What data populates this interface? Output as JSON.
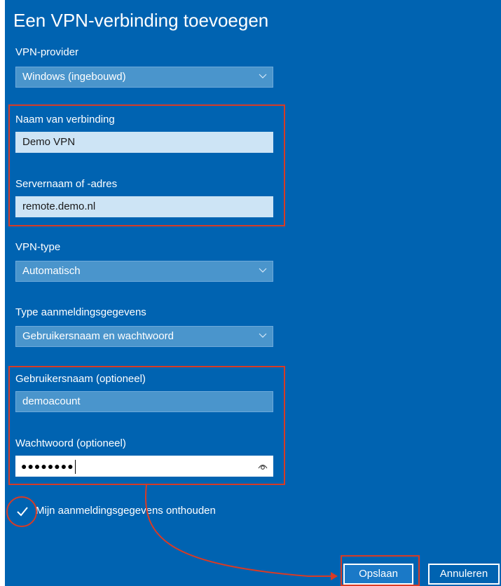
{
  "dialog": {
    "title": "Een VPN-verbinding toevoegen"
  },
  "vpn_provider": {
    "label": "VPN-provider",
    "value": "Windows (ingebouwd)"
  },
  "connection_name": {
    "label": "Naam van verbinding",
    "value": "Demo VPN"
  },
  "server": {
    "label": "Servernaam of -adres",
    "value": "remote.demo.nl"
  },
  "vpn_type": {
    "label": "VPN-type",
    "value": "Automatisch"
  },
  "credential_type": {
    "label": "Type aanmeldingsgegevens",
    "value": "Gebruikersnaam en wachtwoord"
  },
  "username": {
    "label": "Gebruikersnaam (optioneel)",
    "value": "demoacount"
  },
  "password": {
    "label": "Wachtwoord (optioneel)",
    "masked_value": "●●●●●●●●"
  },
  "remember": {
    "label": "Mijn aanmeldingsgegevens onthouden",
    "checked": true
  },
  "buttons": {
    "save": "Opslaan",
    "cancel": "Annuleren"
  },
  "colors": {
    "background": "#0063b1",
    "annotation": "#d83b25",
    "field_light": "#cde4f5",
    "field_dim": "#4a95cc"
  },
  "icons": {
    "dropdown": "chevron-down-icon",
    "reveal_password": "eye-icon",
    "checkbox": "checkmark-icon"
  }
}
